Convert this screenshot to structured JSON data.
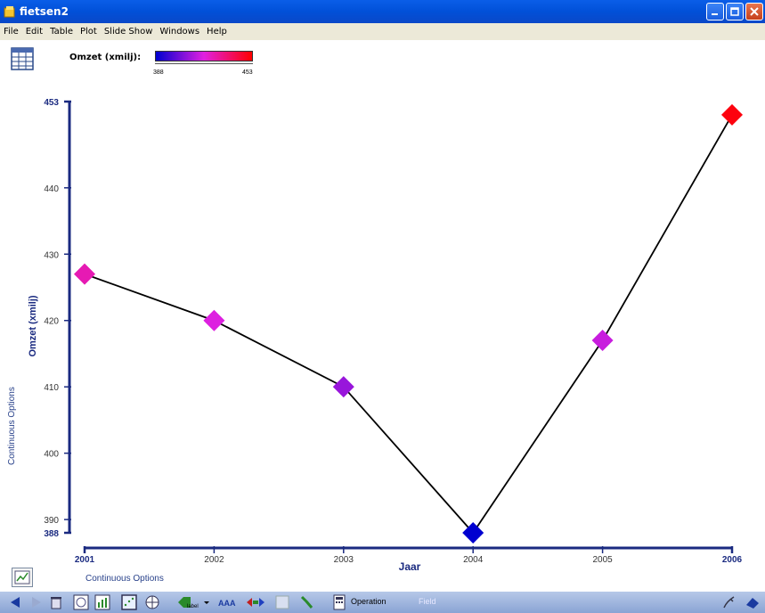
{
  "window": {
    "title": "fietsen2"
  },
  "menu": [
    "File",
    "Edit",
    "Table",
    "Plot",
    "Slide Show",
    "Windows",
    "Help"
  ],
  "legend": {
    "label": "Omzet (xmilj):",
    "min": "388",
    "max": "453",
    "color_low": "#0000d0",
    "color_mid": "#e020e0",
    "color_high": "#ff0000"
  },
  "side_options": "Continuous Options",
  "bottom_options": "Continuous Options",
  "toolbar": {
    "operation_label": "Operation",
    "field_label": "Field",
    "label_tag": "label"
  },
  "chart_data": {
    "type": "line",
    "x": [
      2001,
      2002,
      2003,
      2004,
      2005,
      2006
    ],
    "y": [
      427,
      420,
      410,
      388,
      417,
      451
    ],
    "xlabel": "Jaar",
    "ylabel": "Omzet (xmilj)",
    "ylim": [
      388,
      453
    ],
    "xlim": [
      2001,
      2006
    ],
    "y_ticks": [
      "388",
      "390",
      "400",
      "410",
      "420",
      "430",
      "440",
      "453"
    ],
    "x_ticks": [
      "2001",
      "2002",
      "2003",
      "2004",
      "2005",
      "2006"
    ],
    "marker": "diamond",
    "line_color": "#000000"
  }
}
